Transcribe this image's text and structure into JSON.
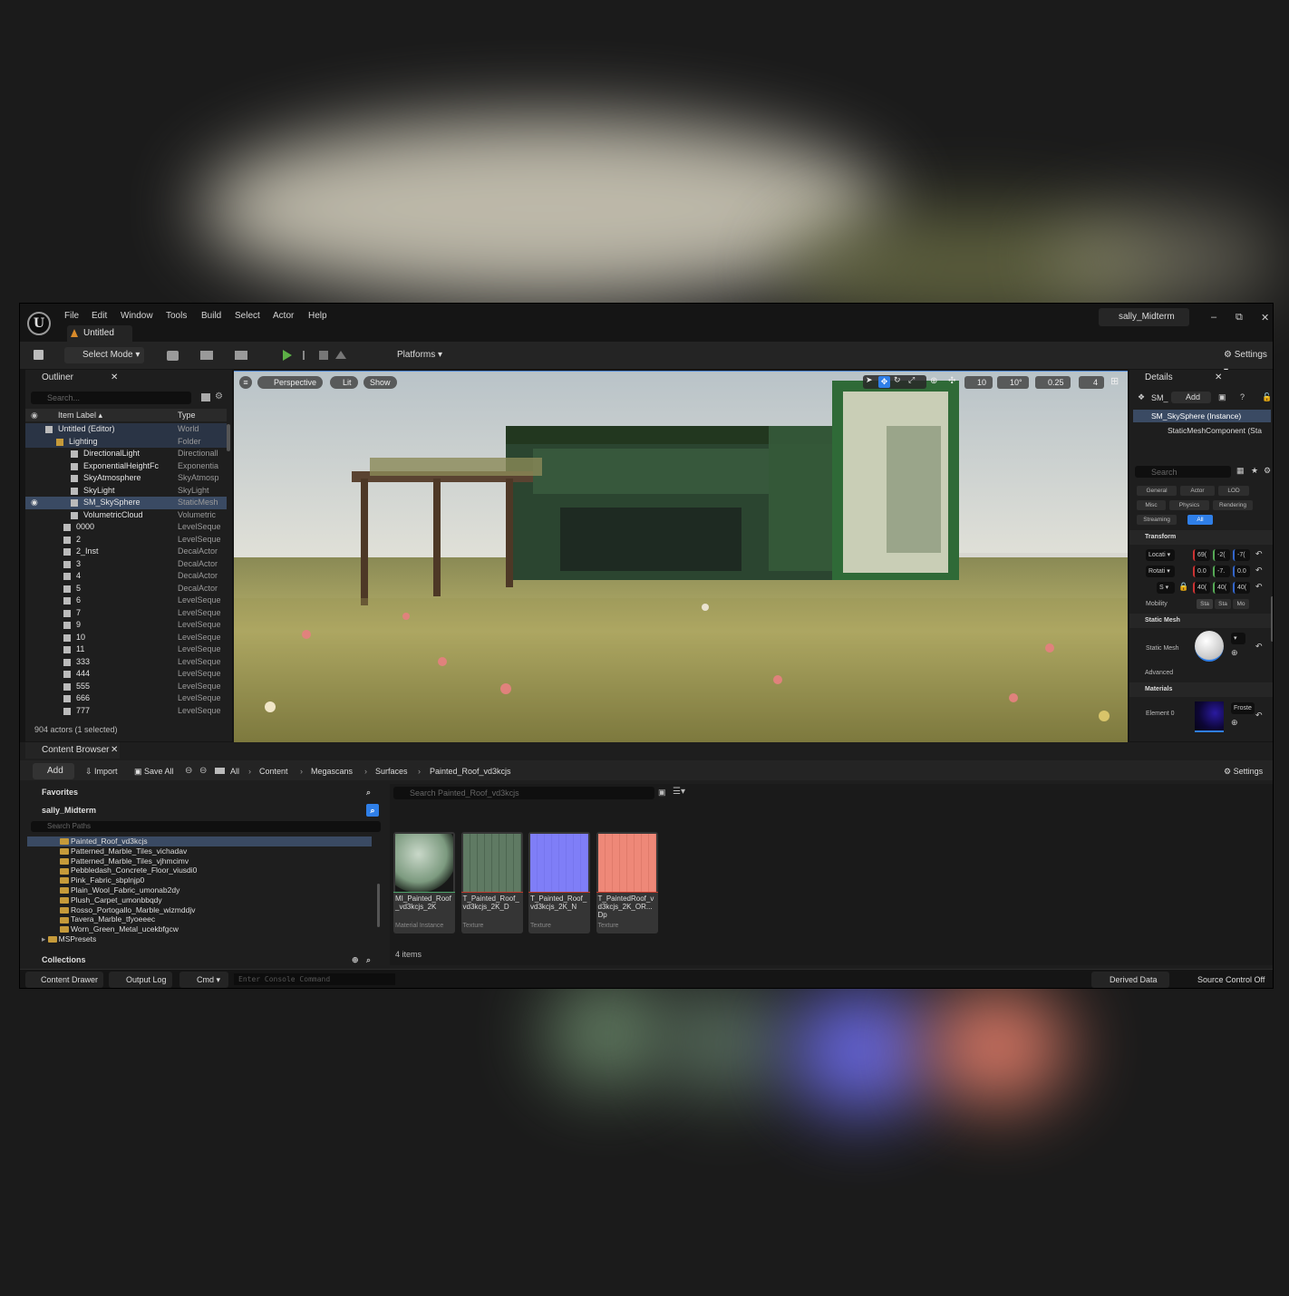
{
  "colors": {
    "accent": "#2f7fe8",
    "selection": "#3a4a63",
    "folder": "#c59a3a"
  },
  "menu": {
    "items": [
      "File",
      "Edit",
      "Window",
      "Tools",
      "Build",
      "Select",
      "Actor",
      "Help"
    ],
    "tab_title": "Untitled",
    "project": "sally_Midterm",
    "minimize": "–",
    "maximize": "⧉",
    "close": "✕"
  },
  "toolbar": {
    "select_mode": "Select Mode",
    "platforms": "Platforms",
    "settings": "Settings"
  },
  "outliner": {
    "title": "Outliner",
    "search_placeholder": "Search...",
    "col_label": "Item Label ▴",
    "col_type": "Type",
    "rows": [
      {
        "label": "Untitled (Editor)",
        "type": "World",
        "indent": 36
      },
      {
        "label": "Lighting",
        "type": "Folder",
        "indent": 48
      },
      {
        "label": "DirectionalLight",
        "type": "Directionall",
        "indent": 64
      },
      {
        "label": "ExponentialHeightFc",
        "type": "Exponentia",
        "indent": 64
      },
      {
        "label": "SkyAtmosphere",
        "type": "SkyAtmosp",
        "indent": 64
      },
      {
        "label": "SkyLight",
        "type": "SkyLight",
        "indent": 64
      },
      {
        "label": "SM_SkySphere",
        "type": "StaticMesh",
        "indent": 64
      },
      {
        "label": "VolumetricCloud",
        "type": "Volumetric",
        "indent": 64
      },
      {
        "label": "0000",
        "type": "LevelSeque",
        "indent": 56
      },
      {
        "label": "2",
        "type": "LevelSeque",
        "indent": 56
      },
      {
        "label": "2_Inst",
        "type": "DecalActor",
        "indent": 56
      },
      {
        "label": "3",
        "type": "DecalActor",
        "indent": 56
      },
      {
        "label": "4",
        "type": "DecalActor",
        "indent": 56
      },
      {
        "label": "5",
        "type": "DecalActor",
        "indent": 56
      },
      {
        "label": "6",
        "type": "LevelSeque",
        "indent": 56
      },
      {
        "label": "7",
        "type": "LevelSeque",
        "indent": 56
      },
      {
        "label": "9",
        "type": "LevelSeque",
        "indent": 56
      },
      {
        "label": "10",
        "type": "LevelSeque",
        "indent": 56
      },
      {
        "label": "11",
        "type": "LevelSeque",
        "indent": 56
      },
      {
        "label": "333",
        "type": "LevelSeque",
        "indent": 56
      },
      {
        "label": "444",
        "type": "LevelSeque",
        "indent": 56
      },
      {
        "label": "555",
        "type": "LevelSeque",
        "indent": 56
      },
      {
        "label": "666",
        "type": "LevelSeque",
        "indent": 56
      },
      {
        "label": "777",
        "type": "LevelSeque",
        "indent": 56
      }
    ],
    "footer": "904 actors (1 selected)"
  },
  "viewport": {
    "perspective": "Perspective",
    "lit": "Lit",
    "show": "Show",
    "grid": "10",
    "angle": "10°",
    "scale": "0.25",
    "camera_speed": "4"
  },
  "details": {
    "title": "Details",
    "actor_short": "SM_",
    "add": "Add",
    "instance": "SM_SkySphere (Instance)",
    "component": "StaticMeshComponent (Sta",
    "search_placeholder": "Search",
    "filters_row1": [
      "General",
      "Actor",
      "LOD"
    ],
    "filters_row2": [
      "Misc",
      "Physics",
      "Rendering"
    ],
    "filters_row3": [
      "Streaming",
      "All"
    ],
    "transform": "Transform",
    "location": "Locati",
    "rotation": "Rotati",
    "scale": "S",
    "loc_vals": [
      "69(",
      "-2(",
      "-7("
    ],
    "rot_vals": [
      "0.0",
      "-7.",
      "0.0"
    ],
    "scale_vals": [
      "40(",
      "40(",
      "40("
    ],
    "mobility": "Mobility",
    "mobility_opts": [
      "Sta",
      "Sta",
      "Mo"
    ],
    "static_mesh_section": "Static Mesh",
    "static_mesh_label": "Static Mesh",
    "advanced": "Advanced",
    "materials": "Materials",
    "element0": "Element 0",
    "material_name": "Froste"
  },
  "content_browser": {
    "title": "Content Browser",
    "add": "Add",
    "import": "Import",
    "save_all": "Save All",
    "breadcrumb": [
      "All",
      "Content",
      "Megascans",
      "Surfaces",
      "Painted_Roof_vd3kcjs"
    ],
    "settings": "Settings",
    "favorites": "Favorites",
    "project": "sally_Midterm",
    "search_paths": "Search Paths",
    "folders": [
      "Painted_Roof_vd3kcjs",
      "Patterned_Marble_Tiles_vichadav",
      "Patterned_Marble_Tiles_vjhmcimv",
      "Pebbledash_Concrete_Floor_viusdi0",
      "Pink_Fabric_sbplnjp0",
      "Plain_Wool_Fabric_umonab2dy",
      "Plush_Carpet_umonbbqdy",
      "Rosso_Portogallo_Marble_wizmddjv",
      "Tavera_Marble_tfyoeeec",
      "Worn_Green_Metal_ucekbfgcw"
    ],
    "mspresets": "MSPresets",
    "collections": "Collections",
    "asset_search": "Search Painted_Roof_vd3kcjs",
    "assets": [
      {
        "name": "MI_Painted_Roof_vd3kcjs_2K",
        "kind": "Material Instance"
      },
      {
        "name": "T_Painted_Roof_vd3kcjs_2K_D",
        "kind": "Texture"
      },
      {
        "name": "T_Painted_Roof_vd3kcjs_2K_N",
        "kind": "Texture"
      },
      {
        "name": "T_PaintedRoof_vd3kcjs_2K_OR...Dp",
        "kind": "Texture"
      }
    ],
    "item_count": "4 items"
  },
  "status": {
    "content_drawer": "Content Drawer",
    "output_log": "Output Log",
    "cmd": "Cmd",
    "console_placeholder": "Enter Console Command",
    "derived_data": "Derived Data",
    "source_control": "Source Control Off"
  }
}
